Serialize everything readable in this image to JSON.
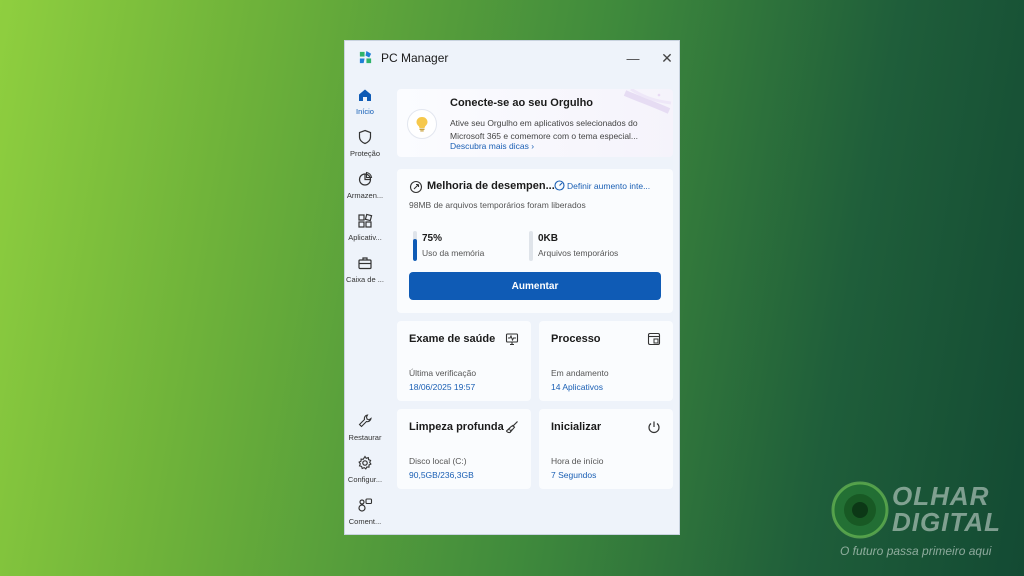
{
  "window": {
    "title": "PC Manager",
    "minimize_glyph": "—",
    "close_glyph": "✕"
  },
  "nav": {
    "items": [
      {
        "label": "Início",
        "icon": "home-icon",
        "active": true
      },
      {
        "label": "Proteção",
        "icon": "shield-icon"
      },
      {
        "label": "Armazen...",
        "icon": "storage-pie-icon"
      },
      {
        "label": "Aplicativ...",
        "icon": "apps-grid-icon"
      },
      {
        "label": "Caixa de ...",
        "icon": "toolbox-icon"
      }
    ],
    "bottom_items": [
      {
        "label": "Restaurar",
        "icon": "wrench-icon"
      },
      {
        "label": "Configur...",
        "icon": "gear-icon"
      },
      {
        "label": "Coment...",
        "icon": "feedback-icon"
      }
    ]
  },
  "promo": {
    "title": "Conecte-se ao seu Orgulho",
    "body": "Ative seu Orgulho em aplicativos selecionados do Microsoft 365 e comemore com o tema especial...",
    "link": "Descubra mais dicas"
  },
  "performance": {
    "title": "Melhoria de desempen...",
    "link": "Definir aumento inte...",
    "description": "98MB de arquivos temporários foram liberados",
    "memory": {
      "value": "75%",
      "label": "Uso da memória",
      "level": 0.75
    },
    "temp_files": {
      "value": "0KB",
      "label": "Arquivos temporários",
      "level": 0
    },
    "button": "Aumentar"
  },
  "tiles": {
    "health": {
      "title": "Exame de saúde",
      "label": "Última verificação",
      "value": "18/06/2025 19:57"
    },
    "process": {
      "title": "Processo",
      "label": "Em andamento",
      "value": "14 Aplicativos"
    },
    "cleanup": {
      "title": "Limpeza profunda",
      "label": "Disco local (C:)",
      "value": "90,5GB/236,3GB"
    },
    "startup": {
      "title": "Inicializar",
      "label": "Hora de início",
      "value": "7 Segundos"
    }
  },
  "watermark": {
    "line1": "OLHAR",
    "line2": "DIGITAL",
    "tagline": "O futuro passa primeiro aqui"
  },
  "colors": {
    "accent": "#0f5bb5",
    "link": "#1a5fb4"
  }
}
